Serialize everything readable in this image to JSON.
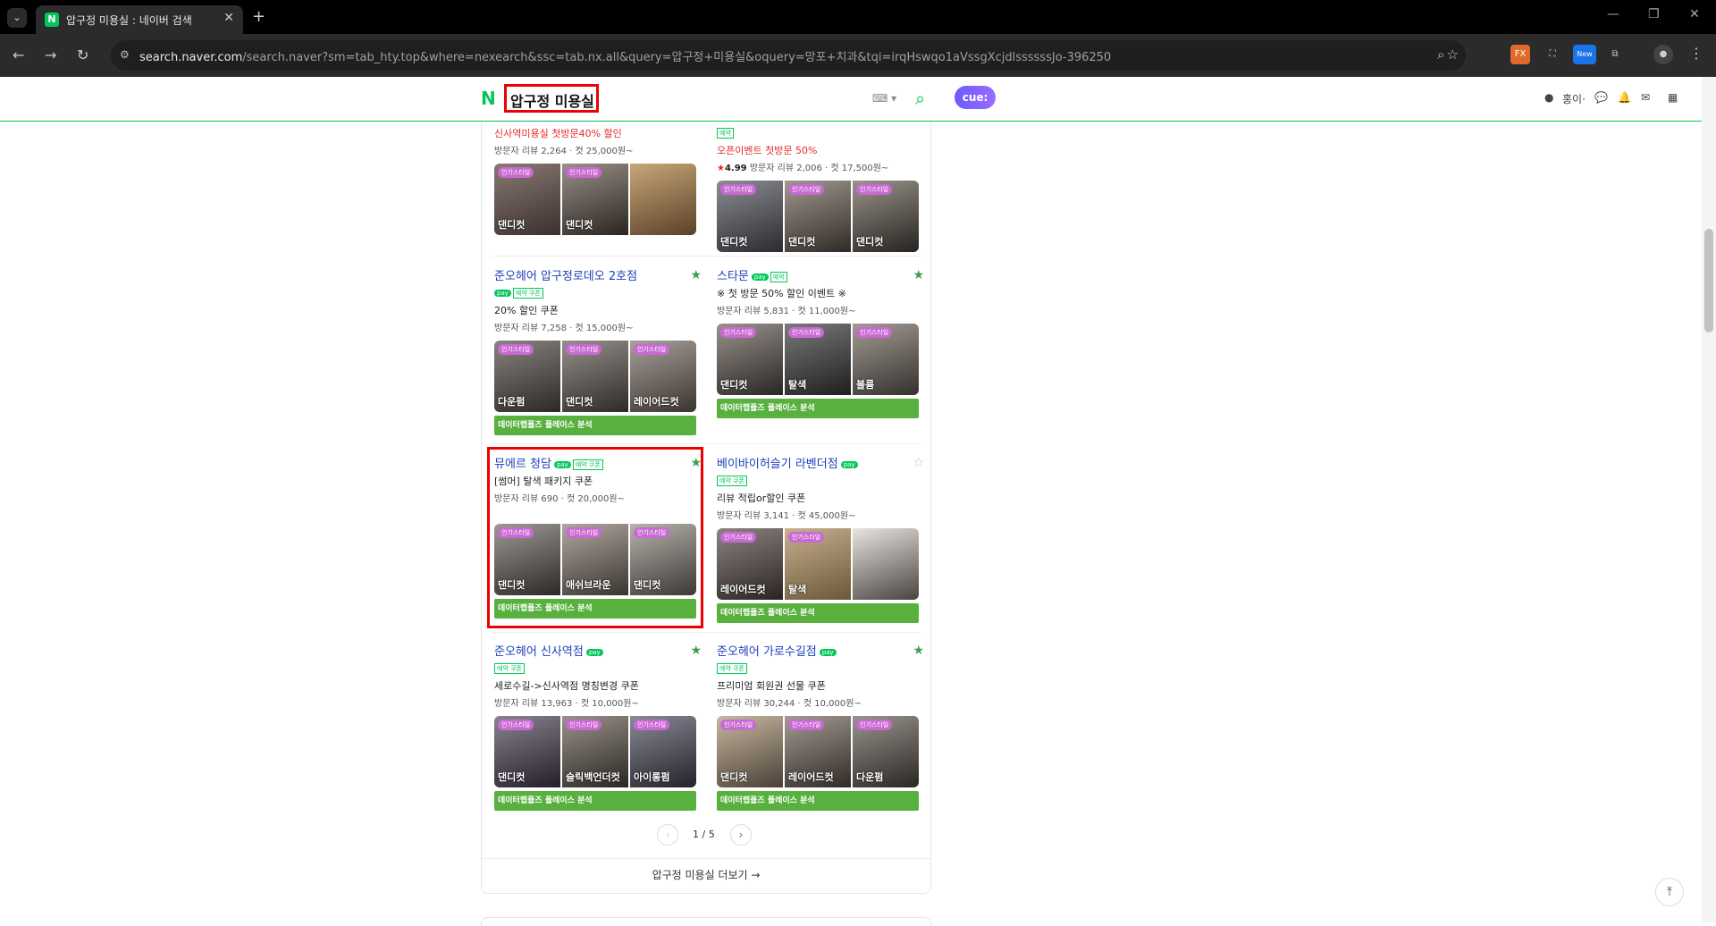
{
  "browser": {
    "tab_title": "압구정 미용실 : 네이버 검색",
    "tab_close": "✕",
    "new_tab": "+",
    "url_host": "search.naver.com",
    "url_rest": "/search.naver?sm=tab_hty.top&where=nexearch&ssc=tab.nx.all&query=압구정+미용실&oquery=망포+치과&tqi=irqHswqo1aVssgXcjdlssssssJo-396250",
    "ext_new_label": "New",
    "ext_fx_label": "FX"
  },
  "header": {
    "logo": "N",
    "search_value": "압구정 미용실",
    "cue_label": "cue:",
    "user_label": "홍이·"
  },
  "cards": [
    {
      "title": "",
      "promo": "신사역미용실 첫방문40% 할인",
      "promo_red": true,
      "stats": "방문자 리뷰 2,264 · 컷 25,000원~",
      "thumbs": [
        {
          "badge": "인기스타일",
          "label": "댄디컷"
        },
        {
          "badge": "인기스타일",
          "label": "댄디컷"
        },
        {
          "badge": "",
          "label": ""
        }
      ],
      "bar": ""
    },
    {
      "title": "",
      "badges_line": "예약",
      "promo": "오픈이벤트 첫방문 50%",
      "promo_red": true,
      "rating": "4.99",
      "stats": "방문자 리뷰 2,006 · 컷 17,500원~",
      "thumbs": [
        {
          "badge": "인기스타일",
          "label": "댄디컷"
        },
        {
          "badge": "인기스타일",
          "label": "댄디컷"
        },
        {
          "badge": "인기스타일",
          "label": "댄디컷"
        }
      ],
      "bar": ""
    },
    {
      "title": "준오헤어 압구정로데오 2호점",
      "badges_line": "예약 쿠폰",
      "promo": "20% 할인 쿠폰",
      "stats": "방문자 리뷰 7,258 · 컷 15,000원~",
      "star": "filled",
      "thumbs": [
        {
          "badge": "인기스타일",
          "label": "다운펌"
        },
        {
          "badge": "인기스타일",
          "label": "댄디컷"
        },
        {
          "badge": "인기스타일",
          "label": "레이어드컷"
        }
      ],
      "bar": "데이터랩플즈 플레이스 분석"
    },
    {
      "title": "스타문",
      "badges_line": "예약",
      "promo": "※ 첫 방문 50% 할인 이벤트 ※",
      "stats": "방문자 리뷰 5,831 · 컷 11,000원~",
      "star": "filled",
      "thumbs": [
        {
          "badge": "인기스타일",
          "label": "댄디컷"
        },
        {
          "badge": "인기스타일",
          "label": "탈색"
        },
        {
          "badge": "인기스타일",
          "label": "볼륨"
        }
      ],
      "bar": "데이터랩플즈 플레이스 분석"
    },
    {
      "title": "뮤에르 청담",
      "badges_line": "예약 쿠폰",
      "promo": "[썸머] 탈색 패키지 쿠폰",
      "stats": "방문자 리뷰 690 · 컷 20,000원~",
      "star": "filled",
      "thumbs": [
        {
          "badge": "인기스타일",
          "label": "댄디컷"
        },
        {
          "badge": "인기스타일",
          "label": "애쉬브라운"
        },
        {
          "badge": "인기스타일",
          "label": "댄디컷"
        }
      ],
      "bar": "데이터랩플즈 플레이스 분석"
    },
    {
      "title": "베이바이허슬기 라벤더점",
      "badges_line": "예약 쿠폰",
      "promo": "리뷰 적립or할인 쿠폰",
      "stats": "방문자 리뷰 3,141 · 컷 45,000원~",
      "star": "empty",
      "thumbs": [
        {
          "badge": "인기스타일",
          "label": "레이어드컷"
        },
        {
          "badge": "인기스타일",
          "label": "탈색"
        },
        {
          "badge": "",
          "label": ""
        }
      ],
      "bar": "데이터랩플즈 플레이스 분석"
    },
    {
      "title": "준오헤어 신사역점",
      "badges_line": "예약 쿠폰",
      "promo": "세로수길->신사역점 명칭변경 쿠폰",
      "stats": "방문자 리뷰 13,963 · 컷 10,000원~",
      "star": "filled",
      "thumbs": [
        {
          "badge": "인기스타일",
          "label": "댄디컷"
        },
        {
          "badge": "인기스타일",
          "label": "슬릭백언더컷"
        },
        {
          "badge": "인기스타일",
          "label": "아이롱펌"
        }
      ],
      "bar": "데이터랩플즈 플레이스 분석"
    },
    {
      "title": "준오헤어 가로수길점",
      "badges_line": "예약 쿠폰",
      "promo": "프리미엄 회원권 선물 쿠폰",
      "stats": "방문자 리뷰 30,244 · 컷 10,000원~",
      "star": "filled",
      "thumbs": [
        {
          "badge": "인기스타일",
          "label": "댄디컷"
        },
        {
          "badge": "인기스타일",
          "label": "레이어드컷"
        },
        {
          "badge": "인기스타일",
          "label": "다운펌"
        }
      ],
      "bar": "데이터랩플즈 플레이스 분석"
    }
  ],
  "pager": {
    "text": "1 / 5",
    "prev": "‹",
    "next": "›"
  },
  "more_link": "압구정 미용실 더보기 →",
  "top_button": "⤒",
  "colors": {
    "naver_green": "#03c75a",
    "link_blue": "#1a3fb8",
    "bar_green": "#58b03f",
    "highlight_red": "#ee0000"
  }
}
